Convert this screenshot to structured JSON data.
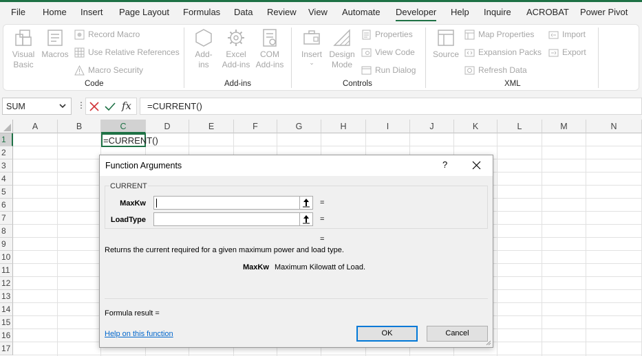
{
  "menu": [
    {
      "label": "File",
      "active": false
    },
    {
      "label": "Home",
      "active": false
    },
    {
      "label": "Insert",
      "active": false
    },
    {
      "label": "Page Layout",
      "active": false
    },
    {
      "label": "Formulas",
      "active": false
    },
    {
      "label": "Data",
      "active": false
    },
    {
      "label": "Review",
      "active": false
    },
    {
      "label": "View",
      "active": false
    },
    {
      "label": "Automate",
      "active": false
    },
    {
      "label": "Developer",
      "active": true
    },
    {
      "label": "Help",
      "active": false
    },
    {
      "label": "Inquire",
      "active": false
    },
    {
      "label": "ACROBAT",
      "active": false
    },
    {
      "label": "Power Pivot",
      "active": false
    }
  ],
  "ribbon": {
    "code": {
      "label": "Code",
      "visual_basic": "Visual\nBasic",
      "macros": "Macros",
      "record_macro": "Record Macro",
      "use_relative_references": "Use Relative References",
      "macro_security": "Macro Security"
    },
    "addins": {
      "label": "Add-ins",
      "addins": "Add-\nins",
      "excel_addins": "Excel\nAdd-ins",
      "com_addins": "COM\nAdd-ins"
    },
    "controls": {
      "label": "Controls",
      "insert": "Insert",
      "design_mode": "Design\nMode",
      "properties": "Properties",
      "view_code": "View Code",
      "run_dialog": "Run Dialog"
    },
    "xml": {
      "label": "XML",
      "source": "Source",
      "map_properties": "Map Properties",
      "expansion_packs": "Expansion Packs",
      "refresh_data": "Refresh Data",
      "import": "Import",
      "export": "Export"
    }
  },
  "formula_bar": {
    "name_box": "SUM",
    "fx": "fx",
    "formula": "=CURRENT()"
  },
  "sheet": {
    "columns": [
      "A",
      "B",
      "C",
      "D",
      "E",
      "F",
      "G",
      "H",
      "I",
      "J",
      "K",
      "L",
      "M",
      "N"
    ],
    "rows": [
      "1",
      "2",
      "3",
      "4",
      "5",
      "6",
      "7",
      "8",
      "9",
      "10",
      "11",
      "12",
      "13",
      "14",
      "15",
      "16",
      "17"
    ],
    "selected_column": "C",
    "selected_row": "1",
    "active_cell_value": "=CURRENT()"
  },
  "dialog": {
    "title": "Function Arguments",
    "help_glyph": "?",
    "function_name": "CURRENT",
    "args": [
      {
        "label": "MaxKw",
        "value": "",
        "result": "="
      },
      {
        "label": "LoadType",
        "value": "",
        "result": "="
      }
    ],
    "overall_equals": "=",
    "description": "Returns the current required for a given maximum power and load type.",
    "arg_desc_name": "MaxKw",
    "arg_desc_text": "Maximum Kilowatt of Load.",
    "formula_result": "Formula result =",
    "help_link": "Help on this function",
    "ok": "OK",
    "cancel": "Cancel"
  }
}
